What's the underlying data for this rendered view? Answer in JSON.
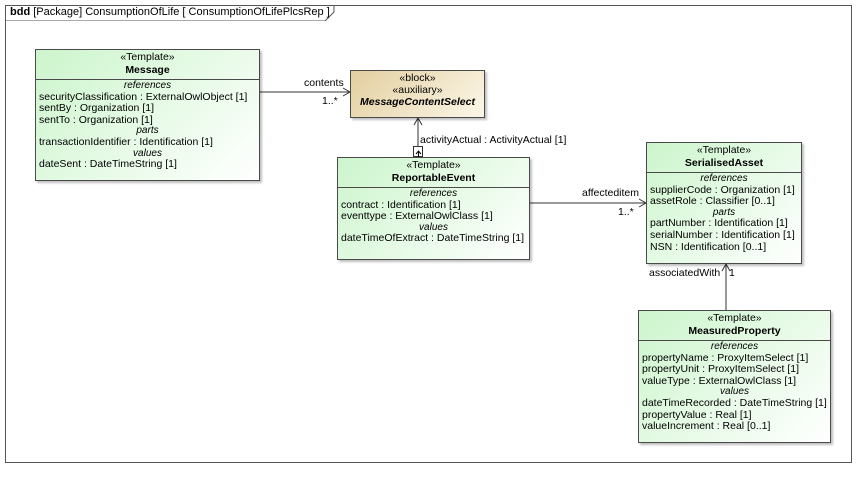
{
  "frame": {
    "kind": "bdd",
    "title": "[Package] ConsumptionOfLife [ ConsumptionOfLifePlcsRep ]"
  },
  "blocks": {
    "message": {
      "stereotype": "«Template»",
      "name": "Message",
      "sections": [
        {
          "title": "references",
          "props": [
            {
              "n": "securityClassification",
              "t": " : ExternalOwlObject [1]"
            },
            {
              "n": "sentBy",
              "t": " : Organization [1]"
            },
            {
              "n": "sentTo",
              "t": " : Organization [1]"
            }
          ]
        },
        {
          "title": "parts",
          "props": [
            {
              "n": "transactionIdentifier",
              "t": " : Identification [1]"
            }
          ]
        },
        {
          "title": "values",
          "props": [
            {
              "n": "dateSent",
              "t": " : DateTimeString [1]"
            }
          ]
        }
      ]
    },
    "mcs": {
      "stereotype1": "«block»",
      "stereotype2": "«auxiliary»",
      "name": "MessageContentSelect"
    },
    "reportable": {
      "stereotype": "«Template»",
      "name": "ReportableEvent",
      "sections": [
        {
          "title": "references",
          "props": [
            {
              "n": "contract",
              "t": " : Identification [1]"
            },
            {
              "n": "eventtype",
              "t": " : ExternalOwlClass [1]"
            }
          ]
        },
        {
          "title": "values",
          "props": [
            {
              "n": "dateTimeOfExtract",
              "t": " : DateTimeString [1]"
            }
          ]
        }
      ]
    },
    "serialised": {
      "stereotype": "«Template»",
      "name": "SerialisedAsset",
      "sections": [
        {
          "title": "references",
          "props": [
            {
              "n": "supplierCode",
              "t": " : Organization [1]"
            },
            {
              "n": "assetRole",
              "t": " : Classifier [0..1]"
            }
          ]
        },
        {
          "title": "parts",
          "props": [
            {
              "n": "partNumber",
              "t": " : Identification [1]"
            },
            {
              "n": "serialNumber",
              "t": " : Identification [1]"
            },
            {
              "n": "NSN",
              "t": " : Identification [0..1]"
            }
          ]
        }
      ]
    },
    "measured": {
      "stereotype": "«Template»",
      "name": "MeasuredProperty",
      "sections": [
        {
          "title": "references",
          "props": [
            {
              "n": "propertyName",
              "t": " : ProxyItemSelect [1]"
            },
            {
              "n": "propertyUnit",
              "t": " : ProxyItemSelect [1]"
            },
            {
              "n": "valueType",
              "t": " : ExternalOwlClass [1]"
            }
          ]
        },
        {
          "title": "values",
          "props": [
            {
              "n": "dateTimeRecorded",
              "t": " : DateTimeString [1]"
            },
            {
              "n": "propertyValue",
              "t": " : Real [1]"
            },
            {
              "n": "valueIncrement",
              "t": " : Real [0..1]"
            }
          ]
        }
      ]
    }
  },
  "links": {
    "contents_role": "contents",
    "contents_mult": "1..*",
    "activity_label": "activityActual : ActivityActual [1]",
    "affected_role": "affecteditem",
    "affected_mult": "1..*",
    "associated_role": "associatedWith",
    "associated_mult": "1"
  }
}
